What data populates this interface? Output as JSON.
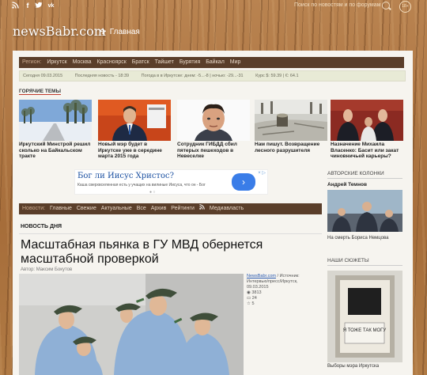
{
  "social": {
    "rss": "rss-icon",
    "facebook": "f",
    "twitter": "twitter-icon",
    "vk": "vk-icon"
  },
  "header": {
    "search_placeholder": "Поиск по новостям и по форумам",
    "age_badge": "18+",
    "logo": "newsBabr.com",
    "home_label": "Главная"
  },
  "regions": {
    "label": "Регион:",
    "items": [
      "Иркутск",
      "Москва",
      "Красноярск",
      "Братск",
      "Тайшет",
      "Бурятия",
      "Байкал",
      "Мир"
    ]
  },
  "infobar": {
    "date": "Сегодня 09.03.2015",
    "last_news": "Последняя новость - 18:39",
    "weather": "Погода в в Иркутске: днем: -5...-8 | ночью: -29...-31",
    "currency": "Курс $: 59.39 | €: 64.1"
  },
  "hot": {
    "title": "ГОРЯЧИЕ ТЕМЫ",
    "items": [
      {
        "caption": "Иркутский Минстрой решил сколько на Байкальском тракте"
      },
      {
        "caption": "Новый мэр будет в Иркутске уже в середине марта 2015 года"
      },
      {
        "caption": "Сотрудник ГИБДД сбил пятерых пешеходов в Невеселке"
      },
      {
        "caption": "Нам пишут. Возвращение лесного разрушителя"
      },
      {
        "caption": "Назначение Михаила Власенко: Басит или закат чиновничьей карьеры?"
      }
    ]
  },
  "ad": {
    "title": "Бог ли Иисус Христос?",
    "desc": "Каша сверхвселенная есть у учащих на вилиные Иисуса, что он - Бог",
    "button": "›",
    "close": "× ▷"
  },
  "tabs": {
    "items": [
      "Новости:",
      "Главные",
      "Свежие",
      "Актуальные",
      "Все",
      "Архив",
      "Рейтинги",
      "Медиавласть"
    ]
  },
  "article": {
    "section": "НОВОСТЬ ДНЯ",
    "title": "Масштабная пьянка в ГУ МВД обернется масштабной проверкой",
    "author": "Автор: Максим Бокутов",
    "source": "NewsBabr.com",
    "source_text": "/ Источник: Интервью/пресс/Иркутск, 09.03.2015",
    "views": "3813",
    "comments": "24",
    "rating": "5"
  },
  "sidebar": {
    "columns_title": "АВТОРСКИЕ КОЛОНКИ",
    "author": "Андрей Темнов",
    "columns_caption": "На смерть Бориса Немцова",
    "plots_title": "НАШИ СЮЖЕТЫ",
    "plots_sign": "Я ТОЖЕ ТАК МОГУ",
    "plots_caption": "Выборы мэра Иркутска"
  }
}
